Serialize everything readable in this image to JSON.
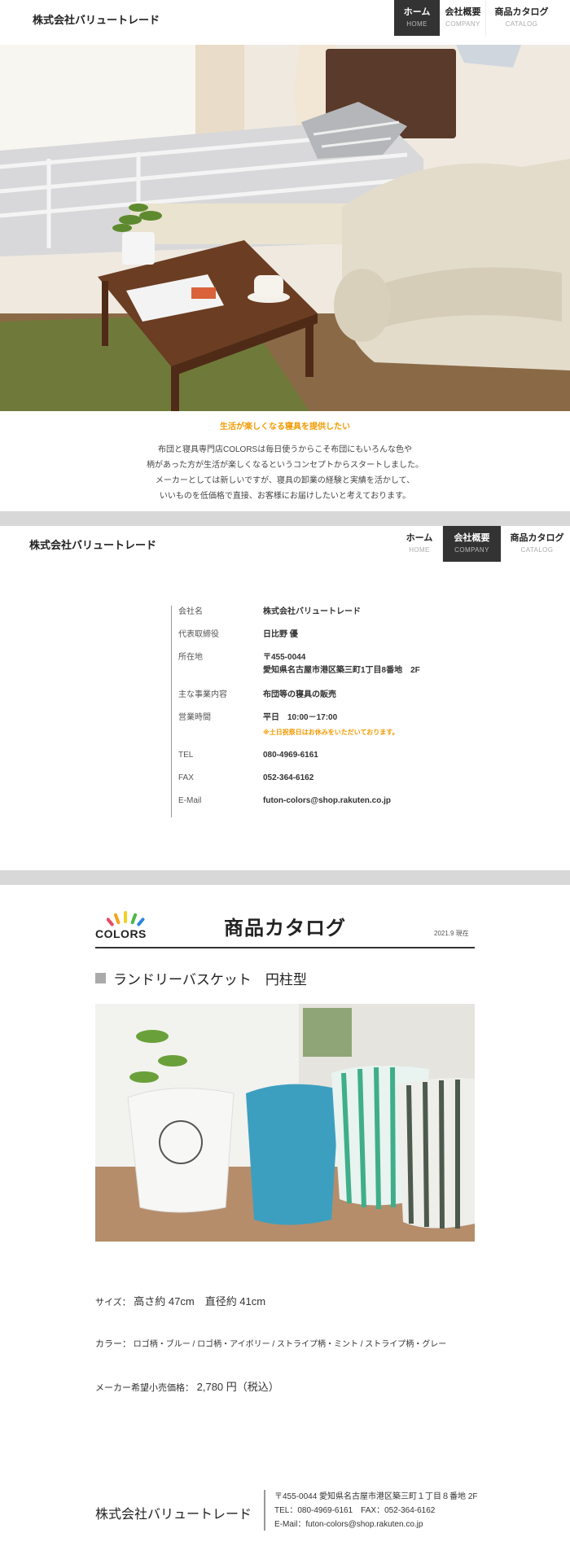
{
  "header1": {
    "brand": "株式会社バリュートレード",
    "nav": [
      {
        "jp": "ホーム",
        "en": "HOME",
        "active": true
      },
      {
        "jp": "会社概要",
        "en": "COMPANY",
        "active": false
      },
      {
        "jp": "商品カタログ",
        "en": "CATALOG",
        "active": false
      }
    ]
  },
  "intro": {
    "title": "生活が楽しくなる寝具を提供したい",
    "body": "布団と寝具専門店COLORSは毎日使うからこそ布団にもいろんな色や\n柄があった方が生活が楽しくなるというコンセプトからスタートしました。\nメーカーとしては新しいですが、寝具の卸業の経験と実績を活かして、\nいいものを低価格で直接、お客様にお届けしたいと考えております。"
  },
  "header2": {
    "brand": "株式会社バリュートレード",
    "nav": [
      {
        "jp": "ホーム",
        "en": "HOME",
        "active": false
      },
      {
        "jp": "会社概要",
        "en": "COMPANY",
        "active": true
      },
      {
        "jp": "商品カタログ",
        "en": "CATALOG",
        "active": false
      }
    ]
  },
  "company": {
    "name_label": "会社名",
    "name": "株式会社バリュートレード",
    "ceo_label": "代表取締役",
    "ceo": "日比野 優",
    "address_label": "所在地",
    "zip": "〒455-0044",
    "address": "愛知県名古屋市港区築三町1丁目8番地　2F",
    "business_label": "主な事業内容",
    "business": "布団等の寝具の販売",
    "hours_label": "営業時間",
    "hours": "平日　10:00－17:00",
    "hours_note": "※土日祝祭日はお休みをいただいております。",
    "tel_label": "TEL",
    "tel": "080-4969-6161",
    "fax_label": "FAX",
    "fax": "052-364-6162",
    "email_label": "E-Mail",
    "email": "futon-colors@shop.rakuten.co.jp"
  },
  "catalog": {
    "logo_text": "COLORS",
    "title": "商品カタログ",
    "date": "2021.9 現在",
    "product_name": "ランドリーバスケット　円柱型",
    "size_key": "サイズ：",
    "size_value": "高さ約 47cm　直径約 41cm",
    "color_key": "カラー：",
    "color_value": "ロゴ柄・ブルー / ロゴ柄・アイボリー / ストライプ柄・ミント / ストライプ柄・グレー",
    "price_key": "メーカー希望小売価格：",
    "price_value": "2,780 円（税込）"
  },
  "footer": {
    "company": "株式会社バリュートレード",
    "address": "〒455-0044 愛知県名古屋市港区築三町１丁目８番地  2F",
    "telfax": "TEL：080-4969-6161　FAX：052-364-6162",
    "email": "E-Mail：futon-colors@shop.rakuten.co.jp"
  },
  "colors": {
    "accent": "#f39a00",
    "nav_active": "#333333",
    "band": "#d8d8d8"
  }
}
